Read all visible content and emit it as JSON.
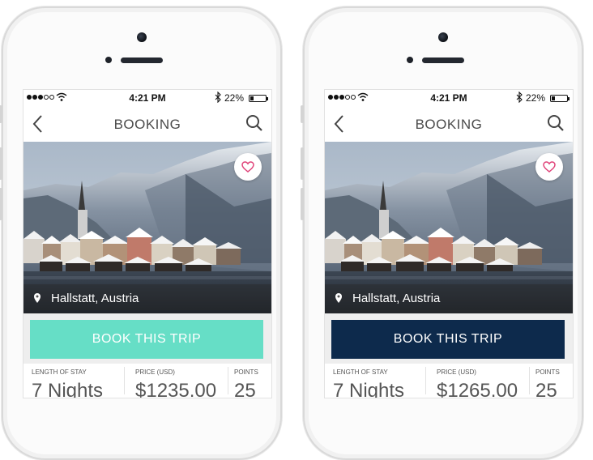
{
  "status_bar": {
    "time": "4:21 PM",
    "battery_percent": "22%",
    "battery_level": 0.22,
    "signal_bars": 3
  },
  "nav": {
    "title": "BOOKING",
    "back_icon": "chevron-left-icon",
    "search_icon": "search-icon"
  },
  "hero": {
    "location": "Hallstatt, Austria",
    "favorite_icon": "heart-icon",
    "pin_icon": "location-pin-icon"
  },
  "cta": {
    "label": "BOOK THIS TRIP"
  },
  "stats": {
    "length_label": "LENGTH OF STAY",
    "length_value": "7 Nights",
    "price_label": "PRICE (USD)",
    "price_value_left": "$1235.00",
    "price_value_right": "$1265.00",
    "points_label": "POINTS",
    "points_value": "25"
  },
  "colors": {
    "teal_button": "#66dec6",
    "navy_button": "#0d2a4c",
    "favorite_heart": "#e0447a"
  }
}
